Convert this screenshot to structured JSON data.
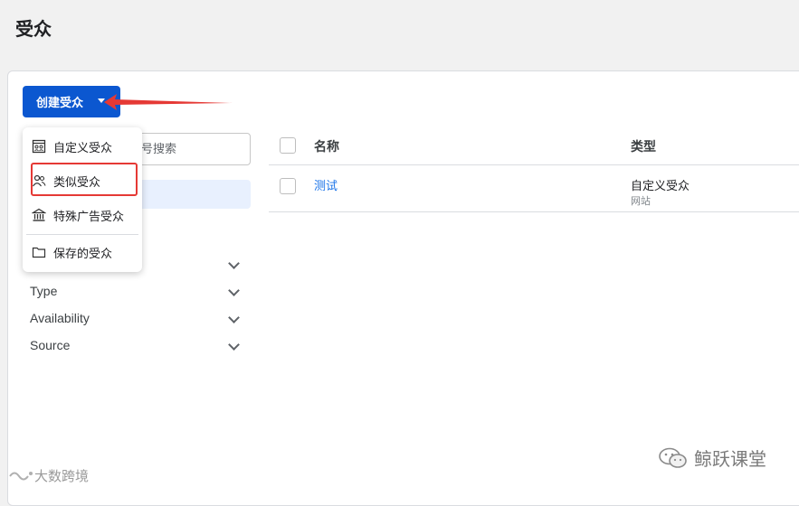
{
  "page": {
    "title": "受众"
  },
  "toolbar": {
    "create_label": "创建受众"
  },
  "search": {
    "placeholder_visible": "号搜索"
  },
  "dropdown": {
    "items": [
      {
        "label": "自定义受众",
        "icon": "custom-audience-icon"
      },
      {
        "label": "类似受众",
        "icon": "people-icon"
      },
      {
        "label": "特殊广告受众",
        "icon": "bank-icon"
      },
      {
        "label": "保存的受众",
        "icon": "folder-icon"
      }
    ]
  },
  "filters": [
    {
      "label": ""
    },
    {
      "label": "Type"
    },
    {
      "label": "Availability"
    },
    {
      "label": "Source"
    }
  ],
  "table": {
    "headers": {
      "name": "名称",
      "type": "类型"
    },
    "rows": [
      {
        "name": "测试",
        "type": "自定义受众",
        "subtype": "网站"
      }
    ]
  },
  "watermark": {
    "right": "鲸跃课堂",
    "left": "大数跨境"
  },
  "colors": {
    "primary": "#0b57d0",
    "highlight": "#e53935",
    "link": "#1a73e8"
  }
}
